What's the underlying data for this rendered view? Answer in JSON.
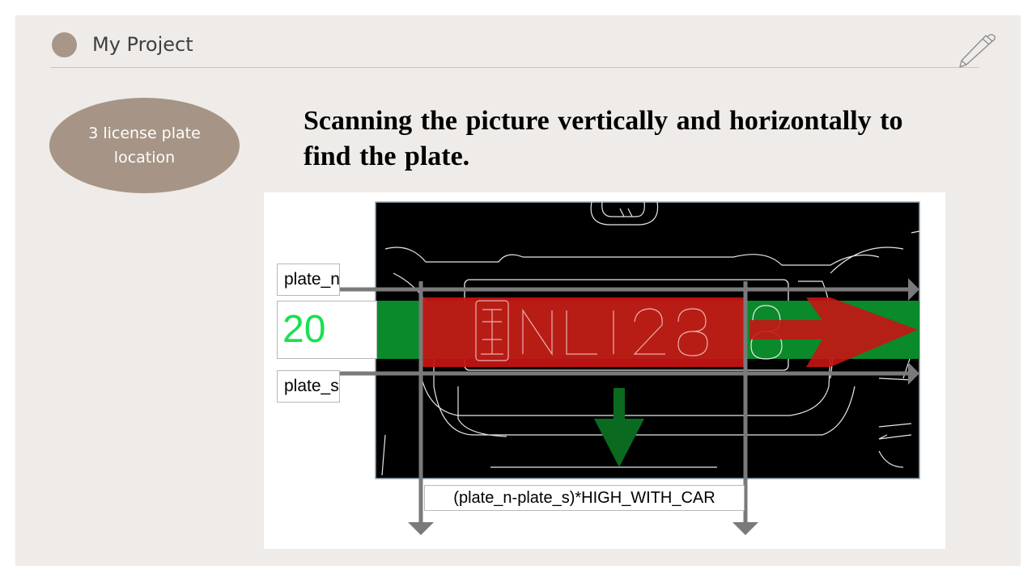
{
  "header": {
    "title": "My Project"
  },
  "section_label": "3 license plate location",
  "heading": "Scanning the picture vertically and  horizontally to find the plate.",
  "figure": {
    "plate_n_label": "plate_n",
    "plate_value": "20",
    "plate_s_label": "plate_s",
    "formula": "(plate_n-plate_s)*HIGH_WITH_CAR",
    "plate_characters": "NLI288",
    "colors": {
      "edge_background": "#000000",
      "scan_highlight_red": "#c81414",
      "scan_band_green": "#0a8a2a",
      "arrow_gray": "#7a7a7a",
      "value_green": "#19e050"
    }
  },
  "icons": {
    "header_dot": "circle-icon",
    "corner": "pen-icon"
  }
}
